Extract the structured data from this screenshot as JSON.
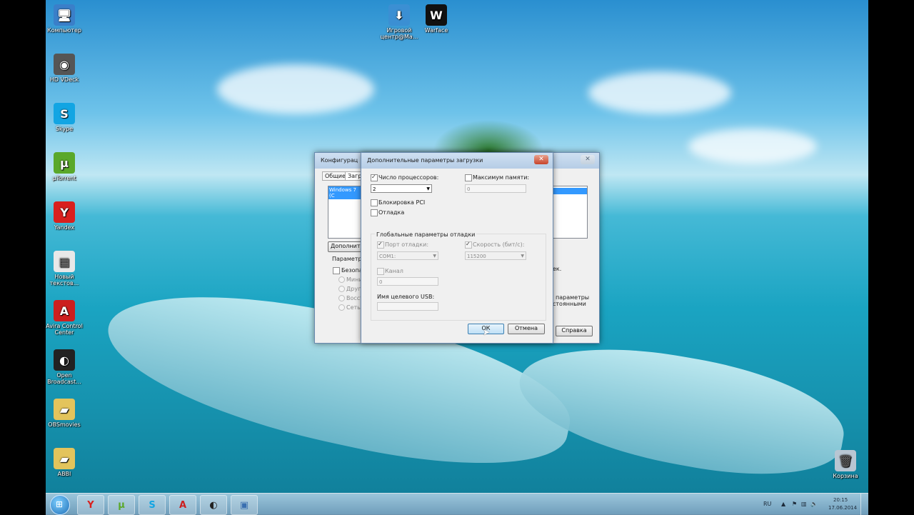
{
  "desktop_icons": [
    {
      "label": "Компьютер",
      "icon": "computer-icon",
      "color": "#3a7fc9",
      "glyph": "🖥"
    },
    {
      "label": "HD VDeck",
      "icon": "hd-vdeck-icon",
      "color": "#555555",
      "glyph": "◉"
    },
    {
      "label": "Skype",
      "icon": "skype-icon",
      "color": "#12a5e3",
      "glyph": "S"
    },
    {
      "label": "µTorrent",
      "icon": "utorrent-icon",
      "color": "#5aa82a",
      "glyph": "µ"
    },
    {
      "label": "Yandex",
      "icon": "yandex-icon",
      "color": "#d9201e",
      "glyph": "Y"
    },
    {
      "label": "Новый текстов...",
      "icon": "text-file-icon",
      "color": "#e8e8e8",
      "glyph": "▤"
    },
    {
      "label": "Avira Control Center",
      "icon": "avira-icon",
      "color": "#cc1f1f",
      "glyph": "A"
    },
    {
      "label": "Open Broadcast...",
      "icon": "obs-icon",
      "color": "#222222",
      "glyph": "◐"
    },
    {
      "label": "OBSmovies",
      "icon": "folder-icon",
      "color": "#e3c45c",
      "glyph": "▰"
    },
    {
      "label": "ABBI",
      "icon": "folder-icon",
      "color": "#e3c45c",
      "glyph": "▰"
    }
  ],
  "top_icons": [
    {
      "label": "Игровой центр@Ма...",
      "icon": "game-center-icon",
      "color": "#3b8fd3",
      "glyph": "⬇"
    },
    {
      "label": "Warface",
      "icon": "warface-icon",
      "color": "#111111",
      "glyph": "W"
    }
  ],
  "recycle": {
    "label": "Корзина",
    "icon": "recycle-bin-icon"
  },
  "back_window": {
    "title": "Конфигурац",
    "tabs": [
      "Общие",
      "Загру"
    ],
    "list_item": "Windows 7 (C",
    "advanced_btn": "Дополнител",
    "params_label": "Параметры",
    "safe_boot": "Безопас",
    "radios": [
      "Мини",
      "Друга",
      "Восст",
      "Сеть"
    ],
    "right_text_1": "ек.",
    "right_text_2": "параметры",
    "right_text_3": "стоянными",
    "help_btn": "Справка"
  },
  "dialog": {
    "title": "Дополнительные параметры загрузки",
    "cpu_label": "Число процессоров:",
    "cpu_value": "2",
    "mem_label": "Максимум памяти:",
    "mem_value": "0",
    "pci_label": "Блокировка PCI",
    "debug_label": "Отладка",
    "group_label": "Глобальные параметры отладки",
    "port_label": "Порт отладки:",
    "port_value": "COM1:",
    "speed_label": "Скорость (бит/с):",
    "speed_value": "115200",
    "channel_label": "Канал",
    "channel_value": "0",
    "usb_label": "Имя целевого USB:",
    "usb_value": "",
    "ok": "ОК",
    "cancel": "Отмена"
  },
  "taskbar": {
    "lang": "RU",
    "time": "20:15",
    "date": "17.06.2014",
    "apps": [
      {
        "name": "yandex-taskbar",
        "glyph": "Y",
        "color": "#d9201e"
      },
      {
        "name": "utorrent-taskbar",
        "glyph": "µ",
        "color": "#5aa82a"
      },
      {
        "name": "skype-taskbar",
        "glyph": "S",
        "color": "#12a5e3"
      },
      {
        "name": "avira-taskbar",
        "glyph": "A",
        "color": "#cc1f1f"
      },
      {
        "name": "obs-taskbar",
        "glyph": "◐",
        "color": "#222222"
      },
      {
        "name": "msconfig-taskbar",
        "glyph": "▣",
        "color": "#3a6fb0"
      }
    ]
  }
}
